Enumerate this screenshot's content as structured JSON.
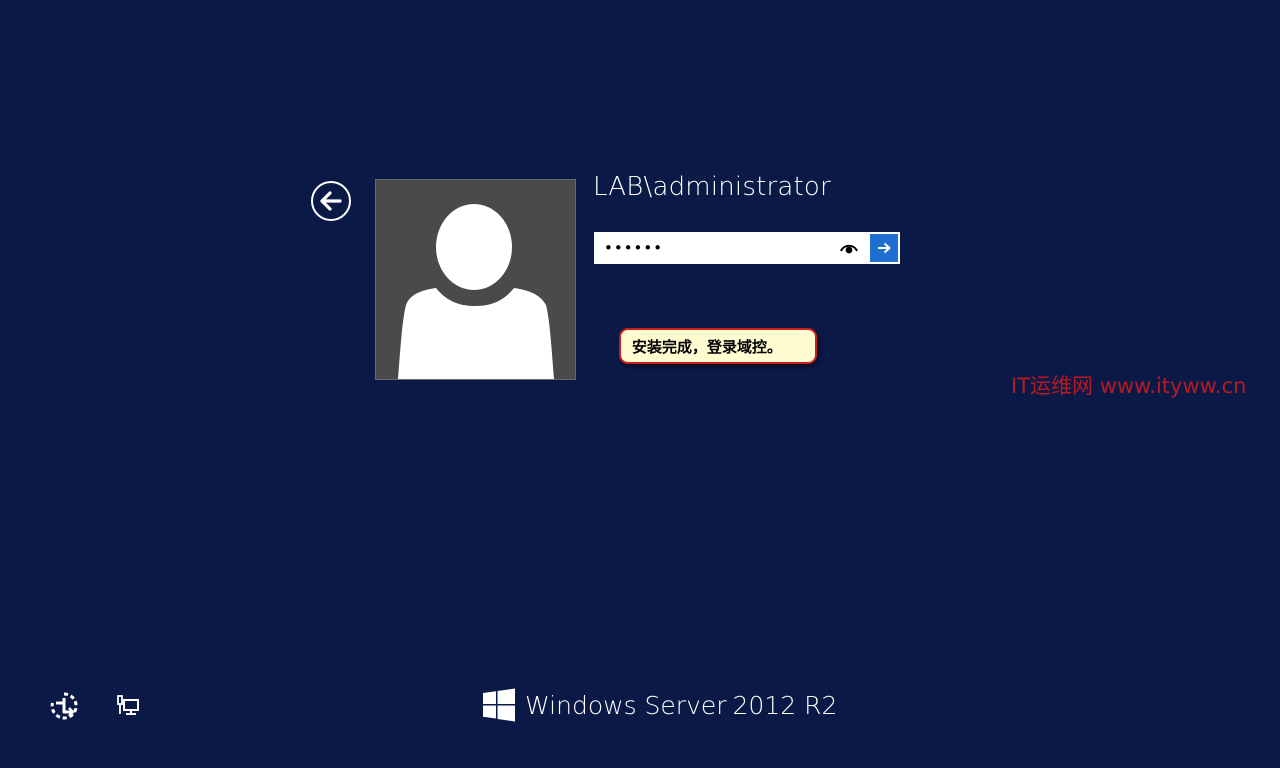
{
  "login": {
    "username": "LAB\\administrator",
    "password_value": "••••••",
    "back_icon": "back-arrow-icon",
    "reveal_icon": "eye-icon",
    "submit_icon": "arrow-right-icon"
  },
  "annotation": {
    "text": "安装完成，登录域控。"
  },
  "watermark": {
    "text": "IT运维网 www.ityww.cn"
  },
  "footer": {
    "ease_of_access_icon": "ease-of-access-icon",
    "network_icon": "network-icon",
    "brand_logo_icon": "windows-logo-icon",
    "brand_name": "Windows Server",
    "brand_version": "2012 R2"
  },
  "colors": {
    "background": "#0b1947",
    "accent": "#1f6fd0",
    "callout_border": "#c81e1e",
    "callout_fill": "#fffbd0",
    "watermark": "#b81a24"
  }
}
